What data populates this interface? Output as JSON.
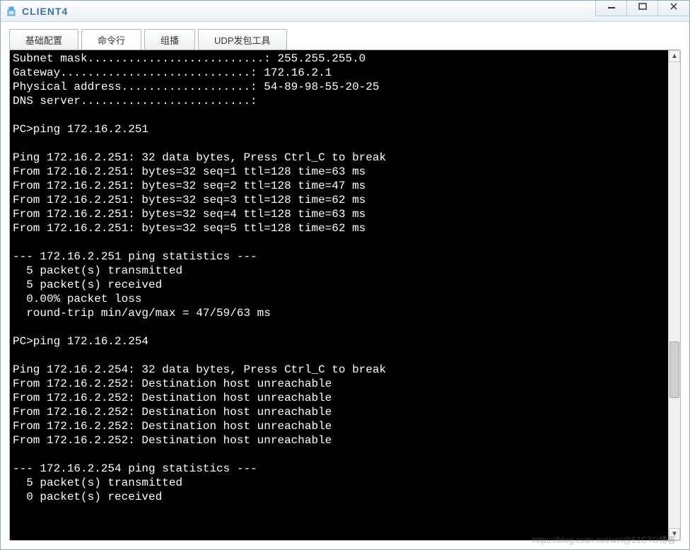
{
  "window": {
    "title": "CLIENT4"
  },
  "tabs": {
    "items": [
      {
        "label": "基础配置"
      },
      {
        "label": "命令行"
      },
      {
        "label": "组播"
      },
      {
        "label": "UDP发包工具"
      }
    ]
  },
  "terminal": {
    "lines": [
      "Subnet mask..........................: 255.255.255.0",
      "Gateway............................: 172.16.2.1",
      "Physical address...................: 54-89-98-55-20-25",
      "DNS server.........................:",
      "",
      "PC>ping 172.16.2.251",
      "",
      "Ping 172.16.2.251: 32 data bytes, Press Ctrl_C to break",
      "From 172.16.2.251: bytes=32 seq=1 ttl=128 time=63 ms",
      "From 172.16.2.251: bytes=32 seq=2 ttl=128 time=47 ms",
      "From 172.16.2.251: bytes=32 seq=3 ttl=128 time=62 ms",
      "From 172.16.2.251: bytes=32 seq=4 ttl=128 time=63 ms",
      "From 172.16.2.251: bytes=32 seq=5 ttl=128 time=62 ms",
      "",
      "--- 172.16.2.251 ping statistics ---",
      "  5 packet(s) transmitted",
      "  5 packet(s) received",
      "  0.00% packet loss",
      "  round-trip min/avg/max = 47/59/63 ms",
      "",
      "PC>ping 172.16.2.254",
      "",
      "Ping 172.16.2.254: 32 data bytes, Press Ctrl_C to break",
      "From 172.16.2.252: Destination host unreachable",
      "From 172.16.2.252: Destination host unreachable",
      "From 172.16.2.252: Destination host unreachable",
      "From 172.16.2.252: Destination host unreachable",
      "From 172.16.2.252: Destination host unreachable",
      "",
      "--- 172.16.2.254 ping statistics ---",
      "  5 packet(s) transmitted",
      "  0 packet(s) received"
    ]
  },
  "watermark": "https://blog.csdn.net/wei@51CTO博客"
}
